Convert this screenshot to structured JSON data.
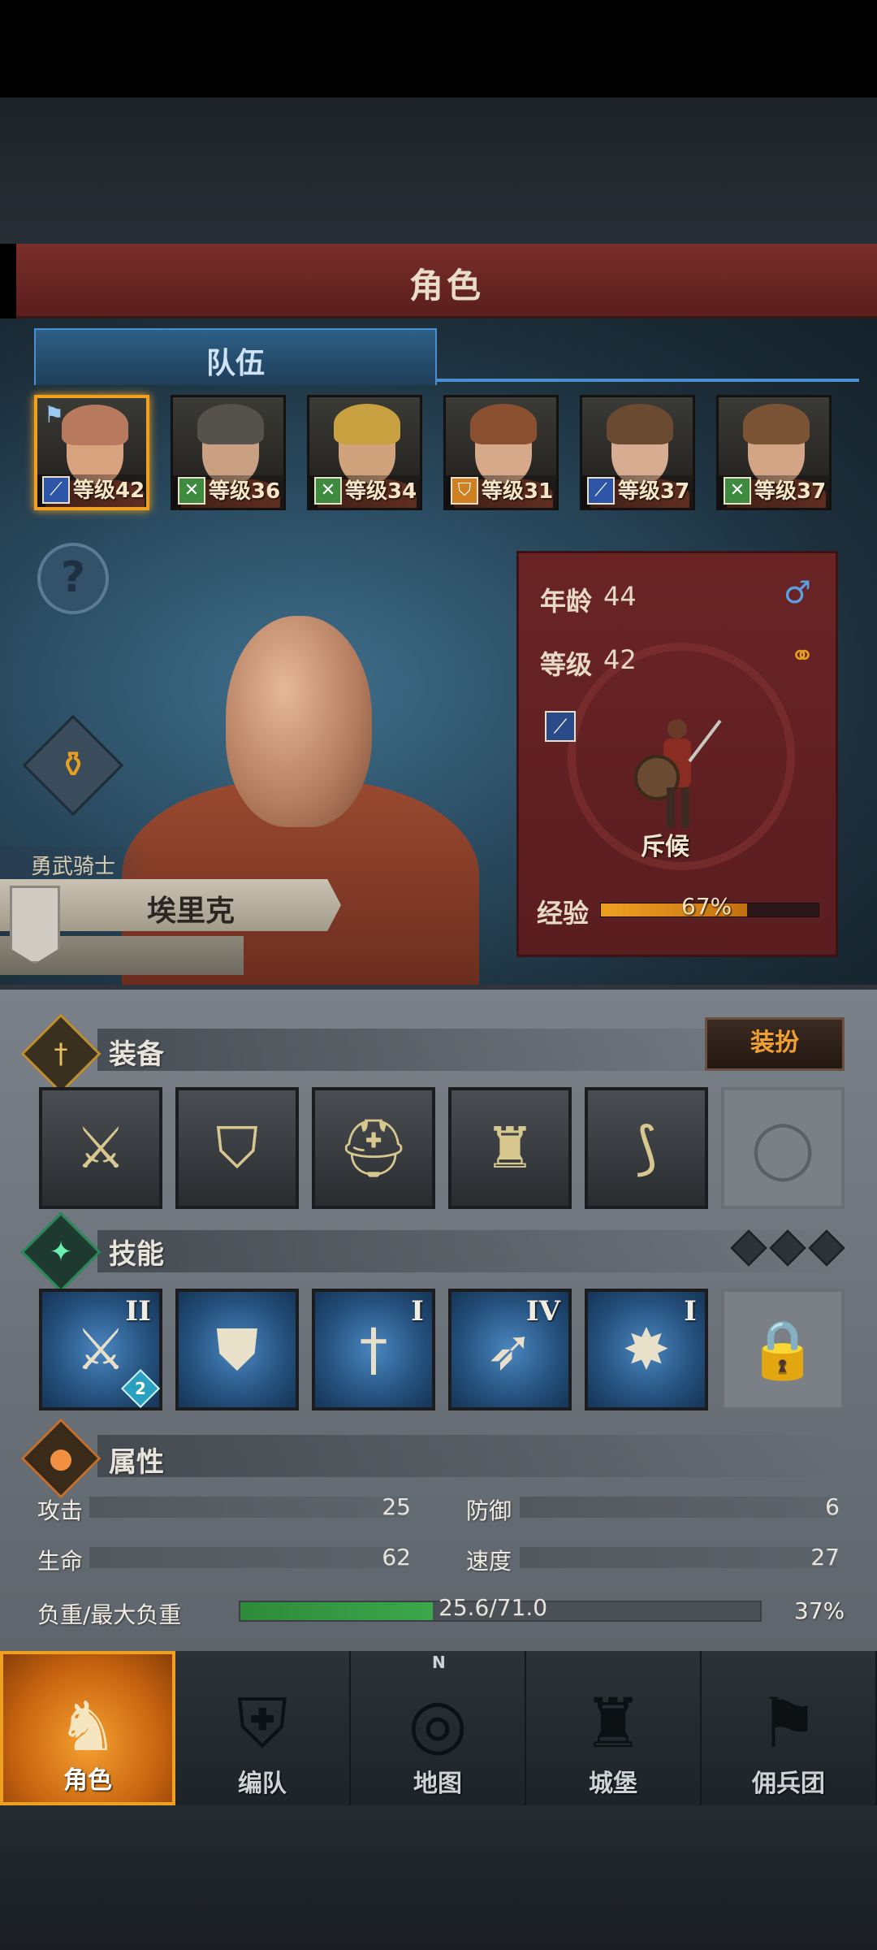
{
  "header": {
    "title": "角色"
  },
  "tabs": {
    "team": "队伍"
  },
  "roster": [
    {
      "level": "等级42",
      "role_icon": "sword-icon",
      "role_color": "#2d55a8",
      "hair": "#b87a5e",
      "skin": "#d9a27f",
      "flag": true,
      "selected": true
    },
    {
      "level": "等级36",
      "role_icon": "bow-icon",
      "role_color": "#3e8a3e",
      "hair": "#55524e",
      "skin": "#c9a082",
      "flag": false,
      "selected": false
    },
    {
      "level": "等级34",
      "role_icon": "bow-icon",
      "role_color": "#3e8a3e",
      "hair": "#c8a040",
      "skin": "#d0a37c",
      "flag": false,
      "selected": false
    },
    {
      "level": "等级31",
      "role_icon": "shield-icon",
      "role_color": "#d08020",
      "hair": "#8a5030",
      "skin": "#d6a98a",
      "flag": false,
      "selected": false
    },
    {
      "level": "等级37",
      "role_icon": "sword-icon",
      "role_color": "#2d55a8",
      "hair": "#6a4a30",
      "skin": "#d8ac90",
      "flag": false,
      "selected": false
    },
    {
      "level": "等级37",
      "role_icon": "bow-icon",
      "role_color": "#3e8a3e",
      "hair": "#7a5234",
      "skin": "#d4a486",
      "flag": false,
      "selected": false
    }
  ],
  "hero": {
    "title": "勇武骑士",
    "name": "埃里克"
  },
  "info": {
    "age_label": "年龄",
    "age_value": "44",
    "level_label": "等级",
    "level_value": "42",
    "role_name": "斥候",
    "exp_label": "经验",
    "exp_value": "67%",
    "exp_fraction": 0.67
  },
  "equipment": {
    "title": "装备",
    "dress_button": "装扮",
    "slots": [
      {
        "name": "sword-slot",
        "glyph": "⚔"
      },
      {
        "name": "shield-slot",
        "glyph": "⛉"
      },
      {
        "name": "helmet-slot",
        "glyph": "⛑"
      },
      {
        "name": "armor-slot",
        "glyph": "♜"
      },
      {
        "name": "boots-slot",
        "glyph": "⟆"
      },
      {
        "name": "ring-slot",
        "glyph": "◯",
        "empty": true
      }
    ]
  },
  "skills": {
    "title": "技能",
    "slots": [
      {
        "name": "skill-blades",
        "glyph": "⚔",
        "rank": "II",
        "badge": "2"
      },
      {
        "name": "skill-shield-bird",
        "glyph": "⛊",
        "rank": "",
        "badge": ""
      },
      {
        "name": "skill-swords",
        "glyph": "†",
        "rank": "I",
        "badge": ""
      },
      {
        "name": "skill-bird",
        "glyph": "➶",
        "rank": "IV",
        "badge": ""
      },
      {
        "name": "skill-shield-burst",
        "glyph": "✸",
        "rank": "I",
        "badge": ""
      },
      {
        "name": "skill-locked",
        "glyph": "🔒",
        "rank": "",
        "badge": "",
        "locked": true
      }
    ]
  },
  "attributes": {
    "title": "属性",
    "attack_label": "攻击",
    "attack_value": "25",
    "defense_label": "防御",
    "defense_value": "6",
    "life_label": "生命",
    "life_value": "62",
    "speed_label": "速度",
    "speed_value": "27",
    "load_label": "负重/最大负重",
    "load_value": "25.6/71.0",
    "load_pct": "37%",
    "load_fraction": 0.37
  },
  "nav": [
    {
      "label": "角色",
      "glyph": "♞",
      "selected": true
    },
    {
      "label": "编队",
      "glyph": "⛨",
      "selected": false
    },
    {
      "label": "地图",
      "glyph": "◎",
      "selected": false
    },
    {
      "label": "城堡",
      "glyph": "♜",
      "selected": false
    },
    {
      "label": "佣兵团",
      "glyph": "⚑",
      "selected": false
    }
  ],
  "compass_letter": "N",
  "colors": {
    "accent": "#f0a020",
    "banner": "#6e2826",
    "tab_blue": "#4a90d0",
    "exp": "#f0a020",
    "load": "#3ca84a"
  }
}
